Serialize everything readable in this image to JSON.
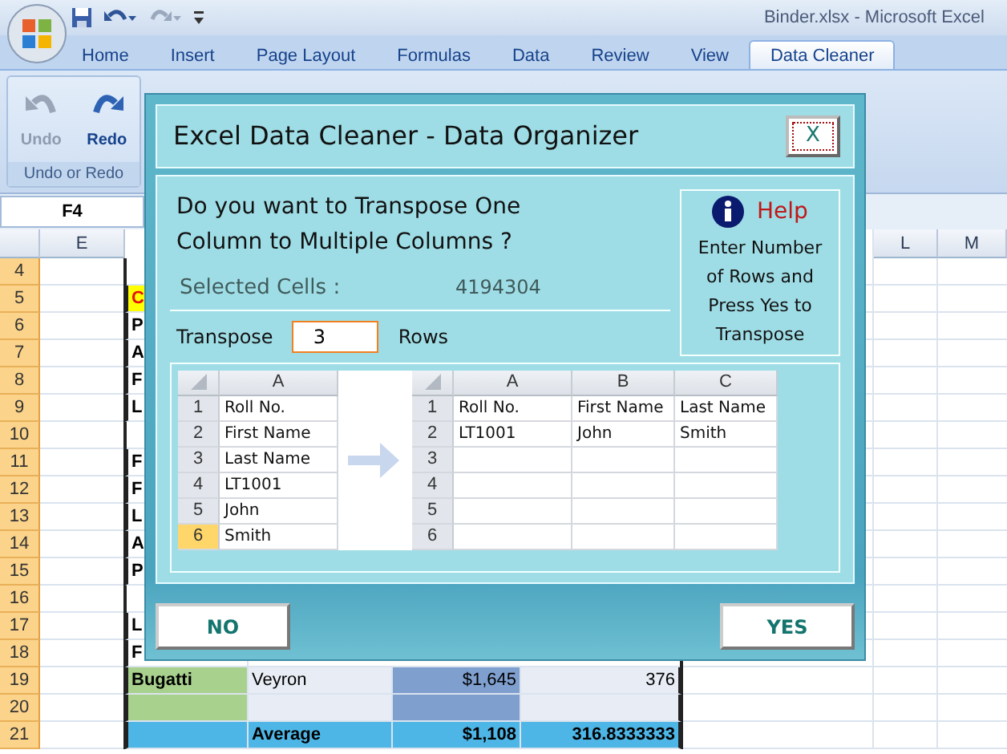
{
  "window": {
    "title": "Binder.xlsx - Microsoft Excel"
  },
  "ribbon_tabs": [
    {
      "label": "Home",
      "selected": false
    },
    {
      "label": "Insert",
      "selected": false
    },
    {
      "label": "Page Layout",
      "selected": false
    },
    {
      "label": "Formulas",
      "selected": false
    },
    {
      "label": "Data",
      "selected": false
    },
    {
      "label": "Review",
      "selected": false
    },
    {
      "label": "View",
      "selected": false
    },
    {
      "label": "Data Cleaner",
      "selected": true
    }
  ],
  "ribbon": {
    "group_label": "Undo or Redo",
    "buttons": [
      {
        "label": "Undo",
        "kind": "undo",
        "disabled": true
      },
      {
        "label": "Redo",
        "kind": "redo",
        "disabled": false
      }
    ]
  },
  "name_box": "F4",
  "sheet": {
    "columns": [
      "E",
      "L",
      "M"
    ],
    "rows": [
      {
        "number": "4",
        "kind": "plain",
        "cells": []
      },
      {
        "number": "5",
        "kind": "heading",
        "cells": [
          "C"
        ]
      },
      {
        "number": "6",
        "kind": "data",
        "cells": [
          "P"
        ]
      },
      {
        "number": "7",
        "kind": "data",
        "cells": [
          "A"
        ]
      },
      {
        "number": "8",
        "kind": "data",
        "cells": [
          "F"
        ]
      },
      {
        "number": "9",
        "kind": "data",
        "cells": [
          "L"
        ]
      },
      {
        "number": "10",
        "kind": "data",
        "cells": []
      },
      {
        "number": "11",
        "kind": "data",
        "cells": [
          "F"
        ]
      },
      {
        "number": "12",
        "kind": "data",
        "cells": [
          "F"
        ]
      },
      {
        "number": "13",
        "kind": "data",
        "cells": [
          "L"
        ]
      },
      {
        "number": "14",
        "kind": "data",
        "cells": [
          "A"
        ]
      },
      {
        "number": "15",
        "kind": "data",
        "cells": [
          "P"
        ]
      },
      {
        "number": "16",
        "kind": "data",
        "cells": []
      },
      {
        "number": "17",
        "kind": "data",
        "cells": [
          "L"
        ]
      },
      {
        "number": "18",
        "kind": "data",
        "cells": [
          "F"
        ]
      },
      {
        "number": "19",
        "kind": "data",
        "cells": [
          "Bugatti",
          "Veyron",
          "$1,645",
          "376"
        ]
      },
      {
        "number": "20",
        "kind": "data",
        "cells": []
      },
      {
        "number": "21",
        "kind": "average",
        "cells": [
          "",
          "Average",
          "$1,108",
          "316.8333333"
        ]
      }
    ]
  },
  "dialog": {
    "title": "Excel Data Cleaner - Data Organizer",
    "close_label": "X",
    "question_lines": [
      "Do you want to Transpose One",
      "Column to Multiple Columns ?"
    ],
    "selected_cells": {
      "label": "Selected Cells :",
      "value": "4194304"
    },
    "transpose": {
      "label": "Transpose",
      "value": "3",
      "unit": "Rows"
    },
    "help": {
      "title": "Help",
      "lines": [
        "Enter Number",
        "of Rows and",
        "Press Yes to",
        "Transpose"
      ]
    },
    "before": {
      "columns": [
        "A"
      ],
      "rows": [
        {
          "number": "1",
          "selected": false,
          "cells": [
            "Roll No."
          ]
        },
        {
          "number": "2",
          "selected": false,
          "cells": [
            "First Name"
          ]
        },
        {
          "number": "3",
          "selected": false,
          "cells": [
            "Last Name"
          ]
        },
        {
          "number": "4",
          "selected": false,
          "cells": [
            "LT1001"
          ]
        },
        {
          "number": "5",
          "selected": false,
          "cells": [
            "John"
          ]
        },
        {
          "number": "6",
          "selected": true,
          "cells": [
            "Smith"
          ]
        }
      ]
    },
    "after": {
      "columns": [
        "A",
        "B",
        "C"
      ],
      "rows": [
        {
          "number": "1",
          "cells": [
            "Roll No.",
            "First Name",
            "Last Name"
          ]
        },
        {
          "number": "2",
          "cells": [
            "LT1001",
            "John",
            "Smith"
          ]
        },
        {
          "number": "3",
          "cells": []
        },
        {
          "number": "4",
          "cells": []
        },
        {
          "number": "5",
          "cells": []
        },
        {
          "number": "6",
          "cells": []
        }
      ]
    },
    "buttons": [
      {
        "label": "NO"
      },
      {
        "label": "YES"
      }
    ]
  }
}
